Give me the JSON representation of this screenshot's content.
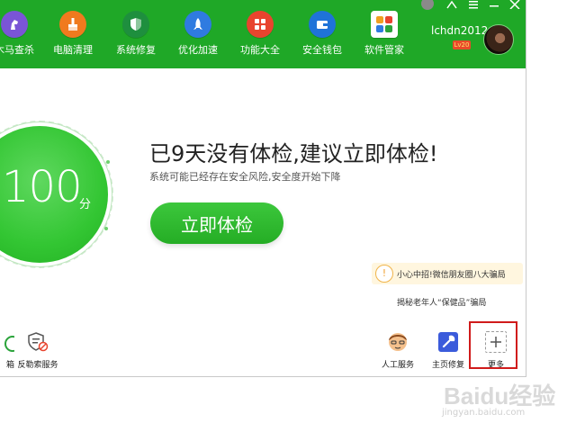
{
  "nav": {
    "items": [
      {
        "label": "木马查杀",
        "icon": "horse-icon",
        "color": "#7a55d6"
      },
      {
        "label": "电脑清理",
        "icon": "broom-icon",
        "color": "#f07a1e"
      },
      {
        "label": "系统修复",
        "icon": "shield-icon",
        "color": "#1e8f3e"
      },
      {
        "label": "优化加速",
        "icon": "rocket-icon",
        "color": "#2f7be0"
      },
      {
        "label": "功能大全",
        "icon": "grid-icon",
        "color": "#e8442e"
      },
      {
        "label": "安全钱包",
        "icon": "wallet-icon",
        "color": "#1f73d8"
      },
      {
        "label": "软件管家",
        "icon": "apps-icon",
        "color": "#2aa33a"
      }
    ]
  },
  "user": {
    "name": "lchdn2012",
    "level": "Lv20"
  },
  "score": {
    "value": "100",
    "unit": "分"
  },
  "status": {
    "headline": "已9天没有体检,建议立即体检!",
    "subline": "系统可能已经存在安全风险,安全度开始下降"
  },
  "actions": {
    "check_now": "立即体检"
  },
  "news": {
    "banner": "小心中招!微信朋友圈八大骗局",
    "link": "揭秘老年人“保健品”骗局"
  },
  "left_tools": [
    {
      "label": "箱"
    },
    {
      "label": "反勒索服务"
    }
  ],
  "tools": [
    {
      "label": "人工服务"
    },
    {
      "label": "主页修复"
    },
    {
      "label": "更多"
    }
  ],
  "watermark": {
    "logo": "Baidu经验",
    "url": "jingyan.baidu.com"
  },
  "colors": {
    "brand_green": "#1fa827",
    "highlight_red": "#d01b1b"
  }
}
